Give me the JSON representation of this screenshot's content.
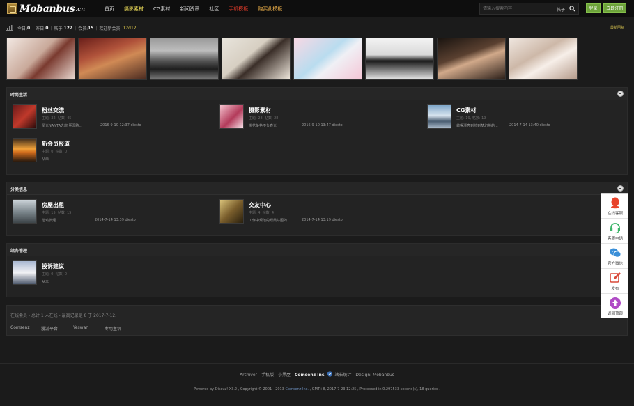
{
  "brand": {
    "logo_main": "Mobanbus",
    "logo_suffix": ".cn"
  },
  "nav": [
    {
      "label": "首页",
      "style": "normal"
    },
    {
      "label": "摄影素材",
      "style": "active"
    },
    {
      "label": "CG素材",
      "style": "normal"
    },
    {
      "label": "新闻资讯",
      "style": "normal"
    },
    {
      "label": "社区",
      "style": "normal"
    },
    {
      "label": "手机模板",
      "style": "red"
    },
    {
      "label": "购买此模板",
      "style": "gold"
    }
  ],
  "search": {
    "placeholder": "请输入搜索内容",
    "type": "帖子",
    "icon": "search-icon"
  },
  "auth": {
    "login": "登录",
    "register": "立即注册"
  },
  "stats": {
    "today_label": "今日:",
    "today": "0",
    "yesterday_label": "昨日:",
    "yesterday": "0",
    "posts_label": "帖子:",
    "posts": "122",
    "members_label": "会员:",
    "members": "15",
    "welcome_label": "欢迎新会员:",
    "new_member": "12d12",
    "latest_link": "最新回复"
  },
  "categories": [
    {
      "title": "时尚生活",
      "forums": [
        {
          "name": "粉丝交流",
          "meta": "主题: 32, 帖数: 45",
          "last": "星光NANTA之旅 明洞购...",
          "time": "2016-9-10 12:37 diesto",
          "icon": "forum-icon"
        },
        {
          "name": "摄影素材",
          "meta": "主题: 28, 帖数: 28",
          "last": "桃花争艳不负春光",
          "time": "2016-9-10 13:47 diesto",
          "icon": "forum-icon"
        },
        {
          "name": "CG素材",
          "meta": "主题: 19, 帖数: 19",
          "last": "做得漂亮到拉到梦幻般的...",
          "time": "2014-7-14 13:40 diesto",
          "icon": "forum-icon"
        },
        {
          "name": "新会员报道",
          "meta": "主题: 0, 帖数: 0",
          "last": "从未",
          "time": "",
          "icon": "forum-icon"
        }
      ]
    },
    {
      "title": "分类信息",
      "forums": [
        {
          "name": "房屋出租",
          "meta": "主题: 15, 帖数: 15",
          "last": "借鸡侦烟",
          "time": "2014-7-14 13:39 diesto",
          "icon": "forum-icon"
        },
        {
          "name": "交友中心",
          "meta": "主题: 4, 帖数: 4",
          "last": "工作中规范的规最好图的...",
          "time": "2014-7-14 13:19 diesto",
          "icon": "forum-icon"
        }
      ]
    },
    {
      "title": "站务管理",
      "forums": [
        {
          "name": "投诉建议",
          "meta": "主题: 0, 帖数: 0",
          "last": "从未",
          "time": "",
          "icon": "forum-icon"
        }
      ]
    }
  ],
  "online": {
    "text": "在线会员 - 总计 1 人在线 - 最高记录是 8 于 2017-7-12."
  },
  "friend_links": [
    "Comsenz",
    "漫游平台",
    "Yeswan",
    "专用主机"
  ],
  "footer": {
    "line1_prefix": "Archiver - 手机版 - 小黑屋 -",
    "line1_company": "Comsenz Inc.",
    "line1_suffix": "站长统计 - Design: Mobanbus",
    "line2_prefix": "Powered by Discuz! X3.2 , Copyright © 2001 - 2013",
    "line2_link": "Comsenz Inc.",
    "line2_suffix": ", GMT+8, 2017-7-23 12:25 , Processed in 0.297533 second(s), 18 queries ."
  },
  "sidebar": [
    {
      "label": "在线客服",
      "icon": "qq-penguin-icon",
      "color": "#e8432b"
    },
    {
      "label": "客服电话",
      "icon": "headset-icon",
      "color": "#3db56a"
    },
    {
      "label": "官方微信",
      "icon": "wechat-icon",
      "color": "#3a8fd8"
    },
    {
      "label": "发布",
      "icon": "edit-icon",
      "color": "#d94a3a"
    },
    {
      "label": "返回顶部",
      "icon": "arrow-up-icon",
      "color": "#b04bc6"
    }
  ]
}
